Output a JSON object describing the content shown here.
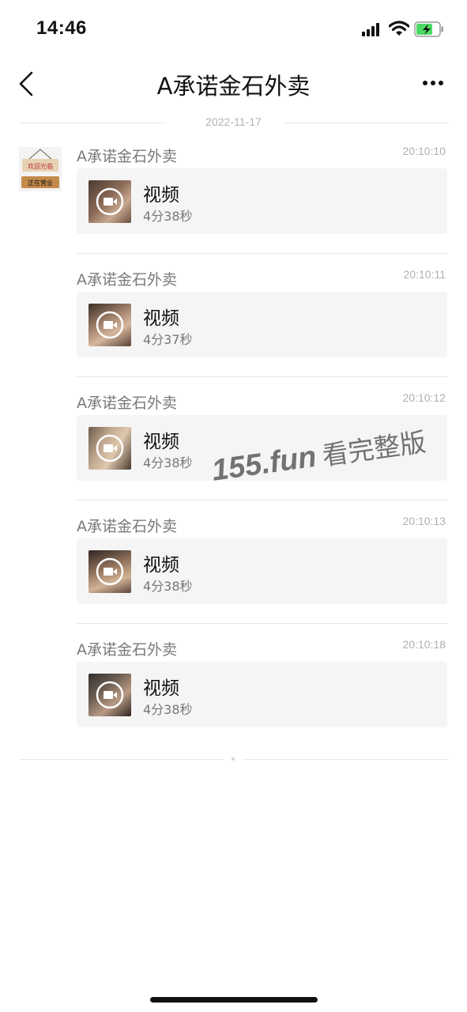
{
  "status_bar": {
    "time": "14:46"
  },
  "header": {
    "title": "A承诺金石外卖"
  },
  "date_separator": "2022-11-17",
  "avatar": {
    "line1": "欢迎光临",
    "line2": "正在营业"
  },
  "messages": [
    {
      "sender": "A承诺金石外卖",
      "time": "20:10:10",
      "label": "视频",
      "duration": "4分38秒"
    },
    {
      "sender": "A承诺金石外卖",
      "time": "20:10:11",
      "label": "视频",
      "duration": "4分37秒"
    },
    {
      "sender": "A承诺金石外卖",
      "time": "20:10:12",
      "label": "视频",
      "duration": "4分38秒"
    },
    {
      "sender": "A承诺金石外卖",
      "time": "20:10:13",
      "label": "视频",
      "duration": "4分38秒"
    },
    {
      "sender": "A承诺金石外卖",
      "time": "20:10:18",
      "label": "视频",
      "duration": "4分38秒"
    }
  ],
  "watermark": {
    "domain": "155.fun",
    "text": "看完整版"
  },
  "icons": {
    "back": "chevron-left-icon",
    "more": "more-dots-icon",
    "play": "video-play-icon",
    "signal": "cellular-signal-icon",
    "wifi": "wifi-icon",
    "battery": "battery-charging-icon"
  },
  "colors": {
    "battery_fill": "#4cd964",
    "card_bg": "#f5f5f5"
  }
}
